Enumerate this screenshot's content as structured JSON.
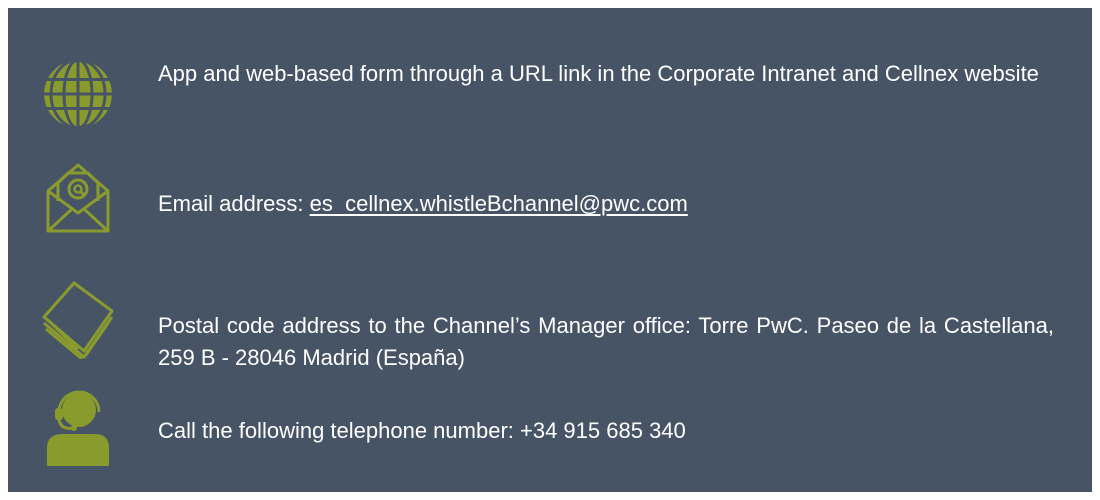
{
  "colors": {
    "panel_background": "#475466",
    "icon_green": "#8A9B2E",
    "text": "#FFFFFF"
  },
  "channels": [
    {
      "icon": "globe-icon",
      "text": "App and web-based form through a URL link in the Corporate Intranet and Cellnex website"
    },
    {
      "icon": "email-envelope-icon",
      "label": "Email address: ",
      "link": "es_cellnex.whistleBchannel@pwc.com"
    },
    {
      "icon": "letters-stack-icon",
      "text": "Postal code address to the Channel’s Manager office: Torre PwC. Paseo de la Castellana, 259 B - 28046 Madrid (España)"
    },
    {
      "icon": "call-center-headset-icon",
      "text": "Call the following telephone number: +34 915 685 340"
    }
  ]
}
